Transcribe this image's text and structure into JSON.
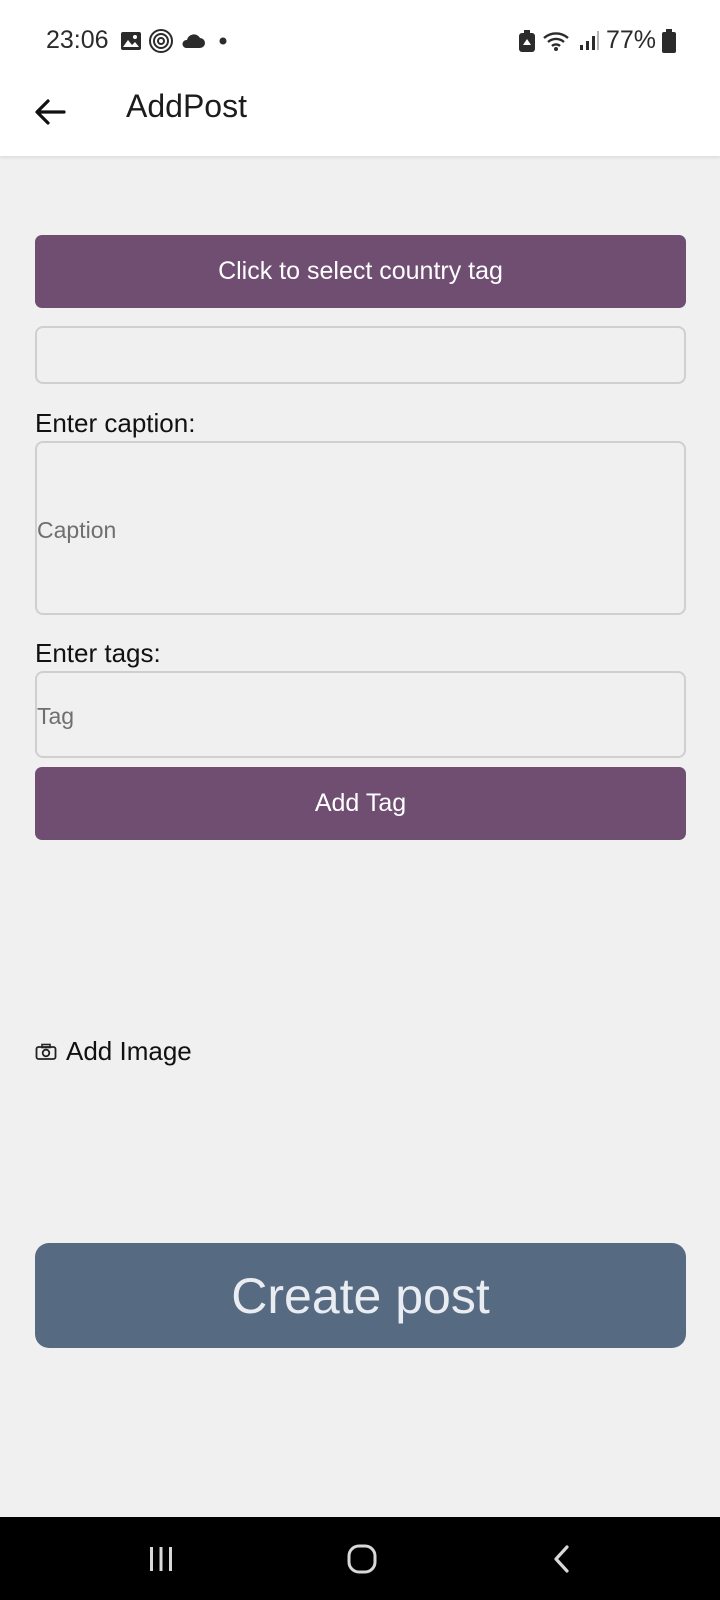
{
  "status_bar": {
    "time": "23:06",
    "battery_percent": "77%",
    "icons": [
      "image-icon",
      "fingerprint-icon",
      "cloud-icon",
      "dot-icon",
      "battery-saver-icon",
      "wifi-icon",
      "signal-icon",
      "battery-icon"
    ]
  },
  "app_bar": {
    "title": "AddPost",
    "back_icon": "arrow-left-icon"
  },
  "form": {
    "country_button_label": "Click to select country tag",
    "country_value": "",
    "caption_label": "Enter caption:",
    "caption_placeholder": "Caption",
    "tags_label": "Enter tags:",
    "tag_placeholder": "Tag",
    "add_tag_label": "Add Tag",
    "add_image_label": "Add Image",
    "add_image_icon": "camera-icon",
    "create_post_label": "Create post"
  },
  "nav_bar": {
    "items": [
      "recent-apps-icon",
      "home-icon",
      "back-icon"
    ]
  },
  "colors": {
    "primary_purple": "#6f4e72",
    "create_button": "#566a82",
    "background": "#f0f0f0"
  }
}
